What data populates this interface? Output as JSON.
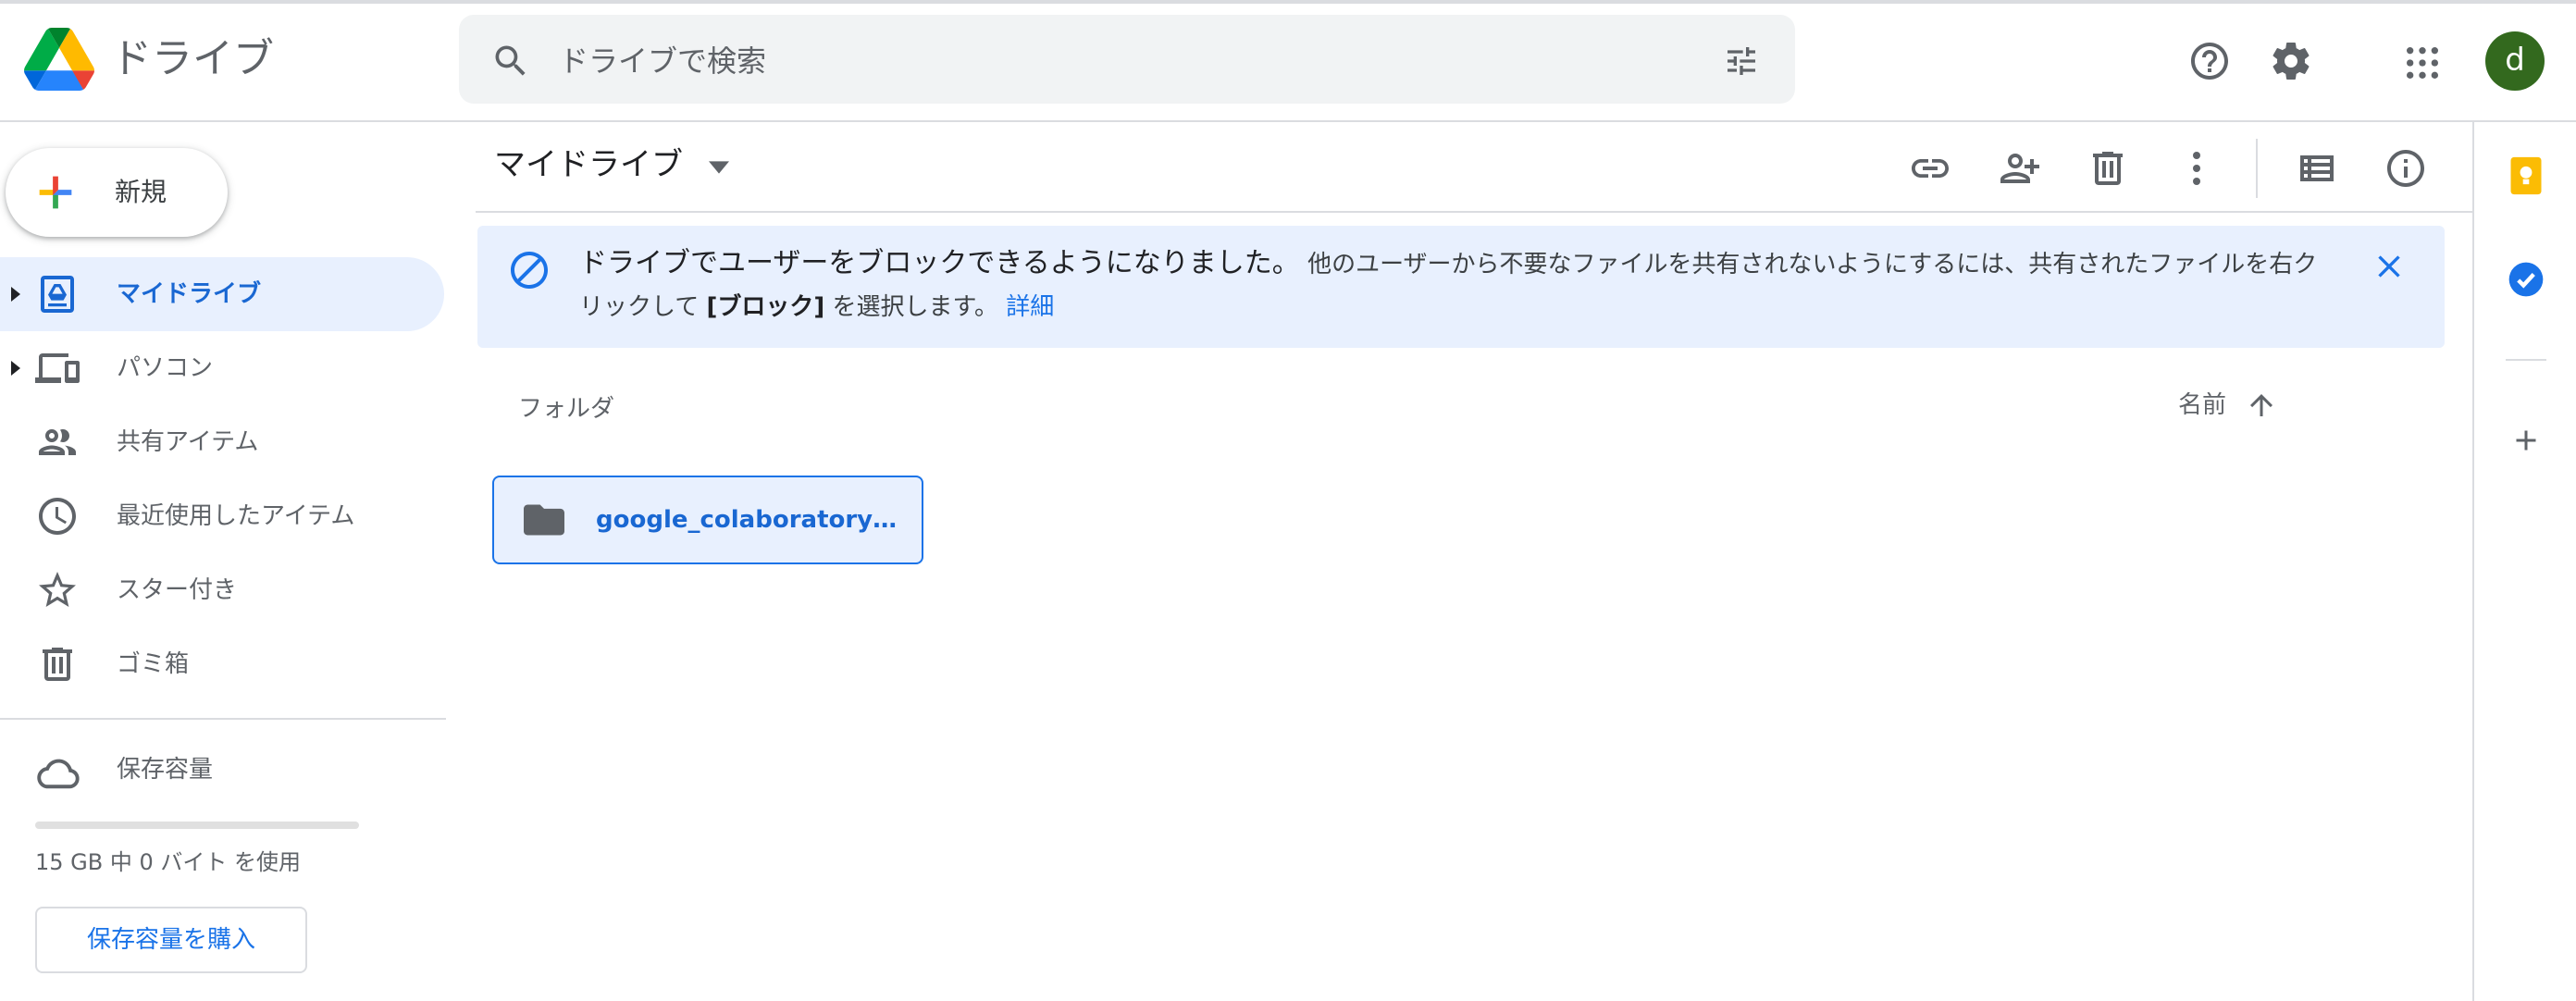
{
  "header": {
    "app_title": "ドライブ",
    "search_placeholder": "ドライブで検索",
    "avatar_letter": "d",
    "avatar_color": "#33691e"
  },
  "sidebar": {
    "new_label": "新規",
    "items": [
      {
        "label": "マイドライブ",
        "icon": "my-drive-icon",
        "active": true,
        "expandable": true
      },
      {
        "label": "パソコン",
        "icon": "computers-icon",
        "active": false,
        "expandable": true
      },
      {
        "label": "共有アイテム",
        "icon": "shared-people-icon",
        "active": false,
        "expandable": false
      },
      {
        "label": "最近使用したアイテム",
        "icon": "clock-icon",
        "active": false,
        "expandable": false
      },
      {
        "label": "スター付き",
        "icon": "star-icon",
        "active": false,
        "expandable": false
      },
      {
        "label": "ゴミ箱",
        "icon": "trash-icon",
        "active": false,
        "expandable": false
      }
    ],
    "storage": {
      "label": "保存容量",
      "usage_text": "15 GB 中 0 バイト を使用",
      "used_fraction": 0,
      "buy_label": "保存容量を購入"
    }
  },
  "main": {
    "breadcrumb": "マイドライブ",
    "toolbar_icons": [
      "link-icon",
      "add-person-icon",
      "trash-icon",
      "more-vert-icon",
      "list-view-icon",
      "info-icon"
    ],
    "banner": {
      "lead": "ドライブでユーザーをブロックできるようになりました。",
      "body_before": "他のユーザーから不要なファイルを共有されないようにするには、共有されたファイルを右クリックして ",
      "bold": "[ブロック]",
      "body_after": " を選択します。",
      "link": "詳細"
    },
    "section_label": "フォルダ",
    "sort_label": "名前",
    "folders": [
      {
        "name": "google_colaboratory_shar..."
      }
    ]
  },
  "colors": {
    "accent": "#1a73e8",
    "active_bg": "#e8f0fe",
    "active_text": "#1967d2"
  }
}
